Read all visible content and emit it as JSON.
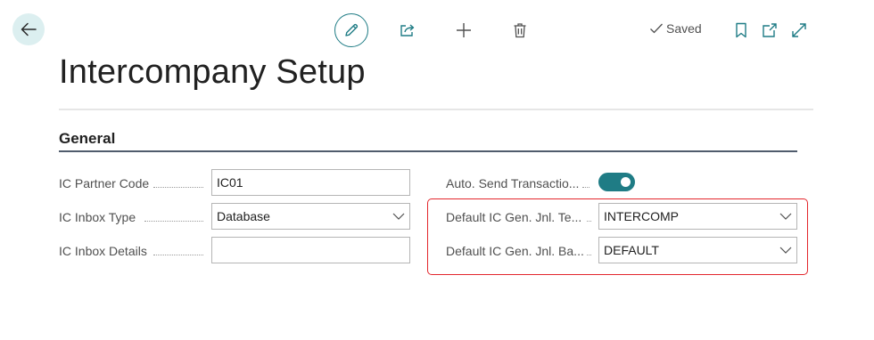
{
  "toolbar": {
    "back_icon": "arrow-left-icon",
    "edit_icon": "pencil-icon",
    "share_icon": "share-icon",
    "new_icon": "plus-icon",
    "delete_icon": "trash-icon",
    "saved_label": "Saved",
    "bookmark_icon": "bookmark-icon",
    "open_new_window_icon": "open-new-window-icon",
    "expand_icon": "expand-icon",
    "accent_color": "#1f7c85"
  },
  "page": {
    "title": "Intercompany Setup"
  },
  "general": {
    "title": "General",
    "ic_partner_code": {
      "label": "IC Partner Code",
      "value": "IC01"
    },
    "ic_inbox_type": {
      "label": "IC Inbox Type",
      "value": "Database"
    },
    "ic_inbox_details": {
      "label": "IC Inbox Details",
      "value": ""
    },
    "auto_send": {
      "label": "Auto. Send Transactio...",
      "value": true
    },
    "default_template": {
      "label": "Default IC Gen. Jnl. Te...",
      "value": "INTERCOMP"
    },
    "default_batch": {
      "label": "Default IC Gen. Jnl. Ba...",
      "value": "DEFAULT"
    }
  },
  "highlight_color": "#e3262c"
}
